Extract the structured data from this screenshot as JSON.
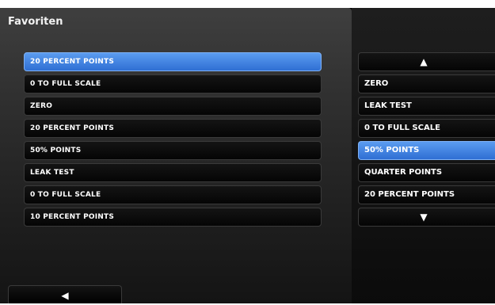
{
  "header": {
    "title": "Favoriten"
  },
  "favorites": {
    "items": [
      {
        "label": "20 PERCENT POINTS",
        "selected": true
      },
      {
        "label": "0 TO FULL SCALE",
        "selected": false
      },
      {
        "label": "ZERO",
        "selected": false
      },
      {
        "label": "20 PERCENT POINTS",
        "selected": false
      },
      {
        "label": "50% POINTS",
        "selected": false
      },
      {
        "label": "LEAK TEST",
        "selected": false
      },
      {
        "label": "0 TO FULL SCALE",
        "selected": false
      },
      {
        "label": "10 PERCENT POINTS",
        "selected": false
      }
    ]
  },
  "options": {
    "scroll_up_glyph": "▲",
    "scroll_down_glyph": "▼",
    "items": [
      {
        "label": "ZERO",
        "selected": false
      },
      {
        "label": "LEAK TEST",
        "selected": false
      },
      {
        "label": "0 TO FULL SCALE",
        "selected": false
      },
      {
        "label": "50% POINTS",
        "selected": true
      },
      {
        "label": "QUARTER POINTS",
        "selected": false
      },
      {
        "label": "20 PERCENT POINTS",
        "selected": false
      }
    ]
  },
  "footer": {
    "back_glyph": "◀"
  },
  "colors": {
    "selected": "#2f6fd3",
    "background": "#000000"
  }
}
